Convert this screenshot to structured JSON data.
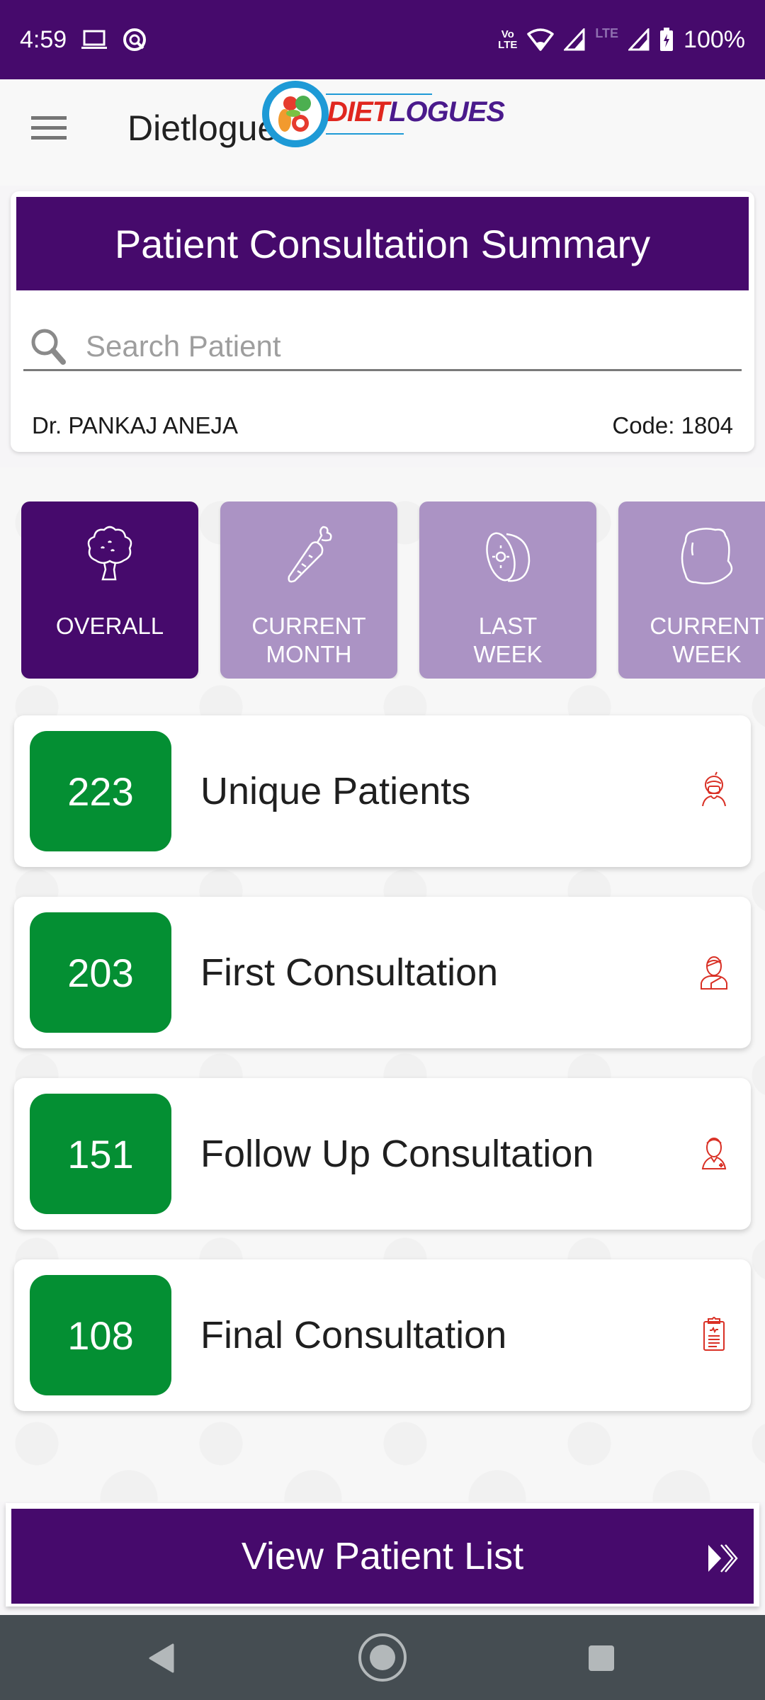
{
  "status_bar": {
    "time": "4:59",
    "left_icons": [
      "laptop-icon",
      "data-saver-icon"
    ],
    "volte_label": "Vo LTE",
    "lte_label": "LTE",
    "battery": "100%"
  },
  "app_bar": {
    "title": "Dietlogue",
    "logo_text_red": "DIET",
    "logo_text_purple": "LOGUES"
  },
  "summary": {
    "title": "Patient Consultation Summary",
    "search_placeholder": "Search Patient",
    "search_value": "",
    "doctor_name": "Dr. PANKAJ ANEJA",
    "code": "Code: 1804"
  },
  "filter_tabs": [
    {
      "label": "OVERALL",
      "icon": "broccoli-icon",
      "active": true
    },
    {
      "label": "CURRENT\nMONTH",
      "icon": "carrot-icon",
      "active": false
    },
    {
      "label": "LAST\nWEEK",
      "icon": "kiwi-icon",
      "active": false
    },
    {
      "label": "CURRENT\nWEEK",
      "icon": "lemon-icon",
      "active": false
    }
  ],
  "stats": [
    {
      "count": "223",
      "label": "Unique Patients",
      "icon": "masked-patient-icon"
    },
    {
      "count": "203",
      "label": "First Consultation",
      "icon": "injured-patient-icon"
    },
    {
      "count": "151",
      "label": "Follow Up Consultation",
      "icon": "nurse-icon"
    },
    {
      "count": "108",
      "label": "Final Consultation",
      "icon": "clipboard-icon"
    }
  ],
  "view_button": {
    "label": "View Patient List"
  },
  "colors": {
    "primary": "#460a6c",
    "tab_inactive": "#ab93c4",
    "count_green": "#048f33",
    "icon_red": "#d93025"
  }
}
